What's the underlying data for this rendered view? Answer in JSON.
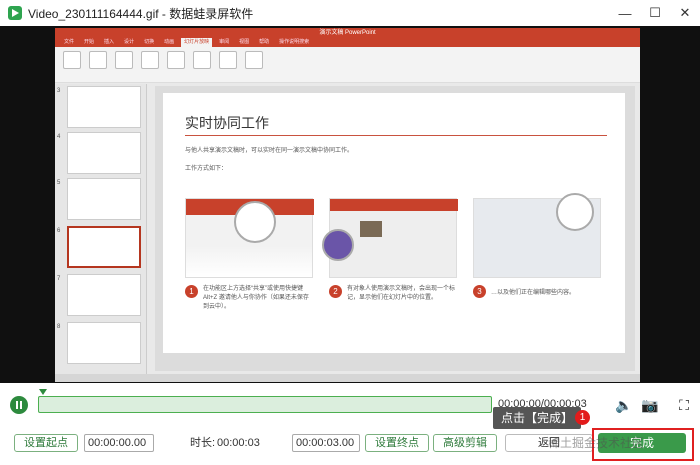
{
  "window": {
    "title": "Video_230111164444.gif - 数据蛙录屏软件",
    "buttons": [
      "minimize",
      "maximize",
      "close"
    ]
  },
  "ppt": {
    "title": "演示文稿 PowerPoint",
    "tabs": [
      "文件",
      "开始",
      "插入",
      "设计",
      "切换",
      "动画",
      "幻灯片放映",
      "审阅",
      "视图",
      "帮助",
      "操作说明搜索"
    ],
    "active_tab": "幻灯片放映",
    "slide": {
      "title": "实时协同工作",
      "intro": "与他人共享演示文稿时，可以实时在同一演示文稿中协同工作。",
      "subtitle": "工作方式如下：",
      "steps": [
        {
          "num": "1",
          "text": "在功能区上方选择“共享”或使用快捷键 Alt+Z 邀请他人与你协作（如果还未保存到云中）。"
        },
        {
          "num": "2",
          "text": "有对象人使用演示文稿时，会出现一个标记，显示他们在幻灯片中的位置。"
        },
        {
          "num": "3",
          "text": "…以及他们正在编辑哪些内容。"
        }
      ]
    },
    "thumb_numbers": [
      "3",
      "4",
      "5",
      "6",
      "7",
      "8"
    ]
  },
  "player": {
    "time": "00:00:00/00:00:03"
  },
  "tooltip": {
    "text": "点击【完成】",
    "badge": "1"
  },
  "bottom": {
    "set_start": "设置起点",
    "start_time": "00:00:00.00",
    "duration_label": "时长:",
    "duration": "00:00:03",
    "end_time": "00:00:03.00",
    "set_end": "设置终点",
    "advanced": "高级剪辑",
    "back": "返回",
    "done": "完成"
  },
  "watermark": "稀土掘金技术社区",
  "colors": {
    "accent": "#2d8a3e",
    "ppt_red": "#c8412b",
    "highlight": "#e02020"
  }
}
